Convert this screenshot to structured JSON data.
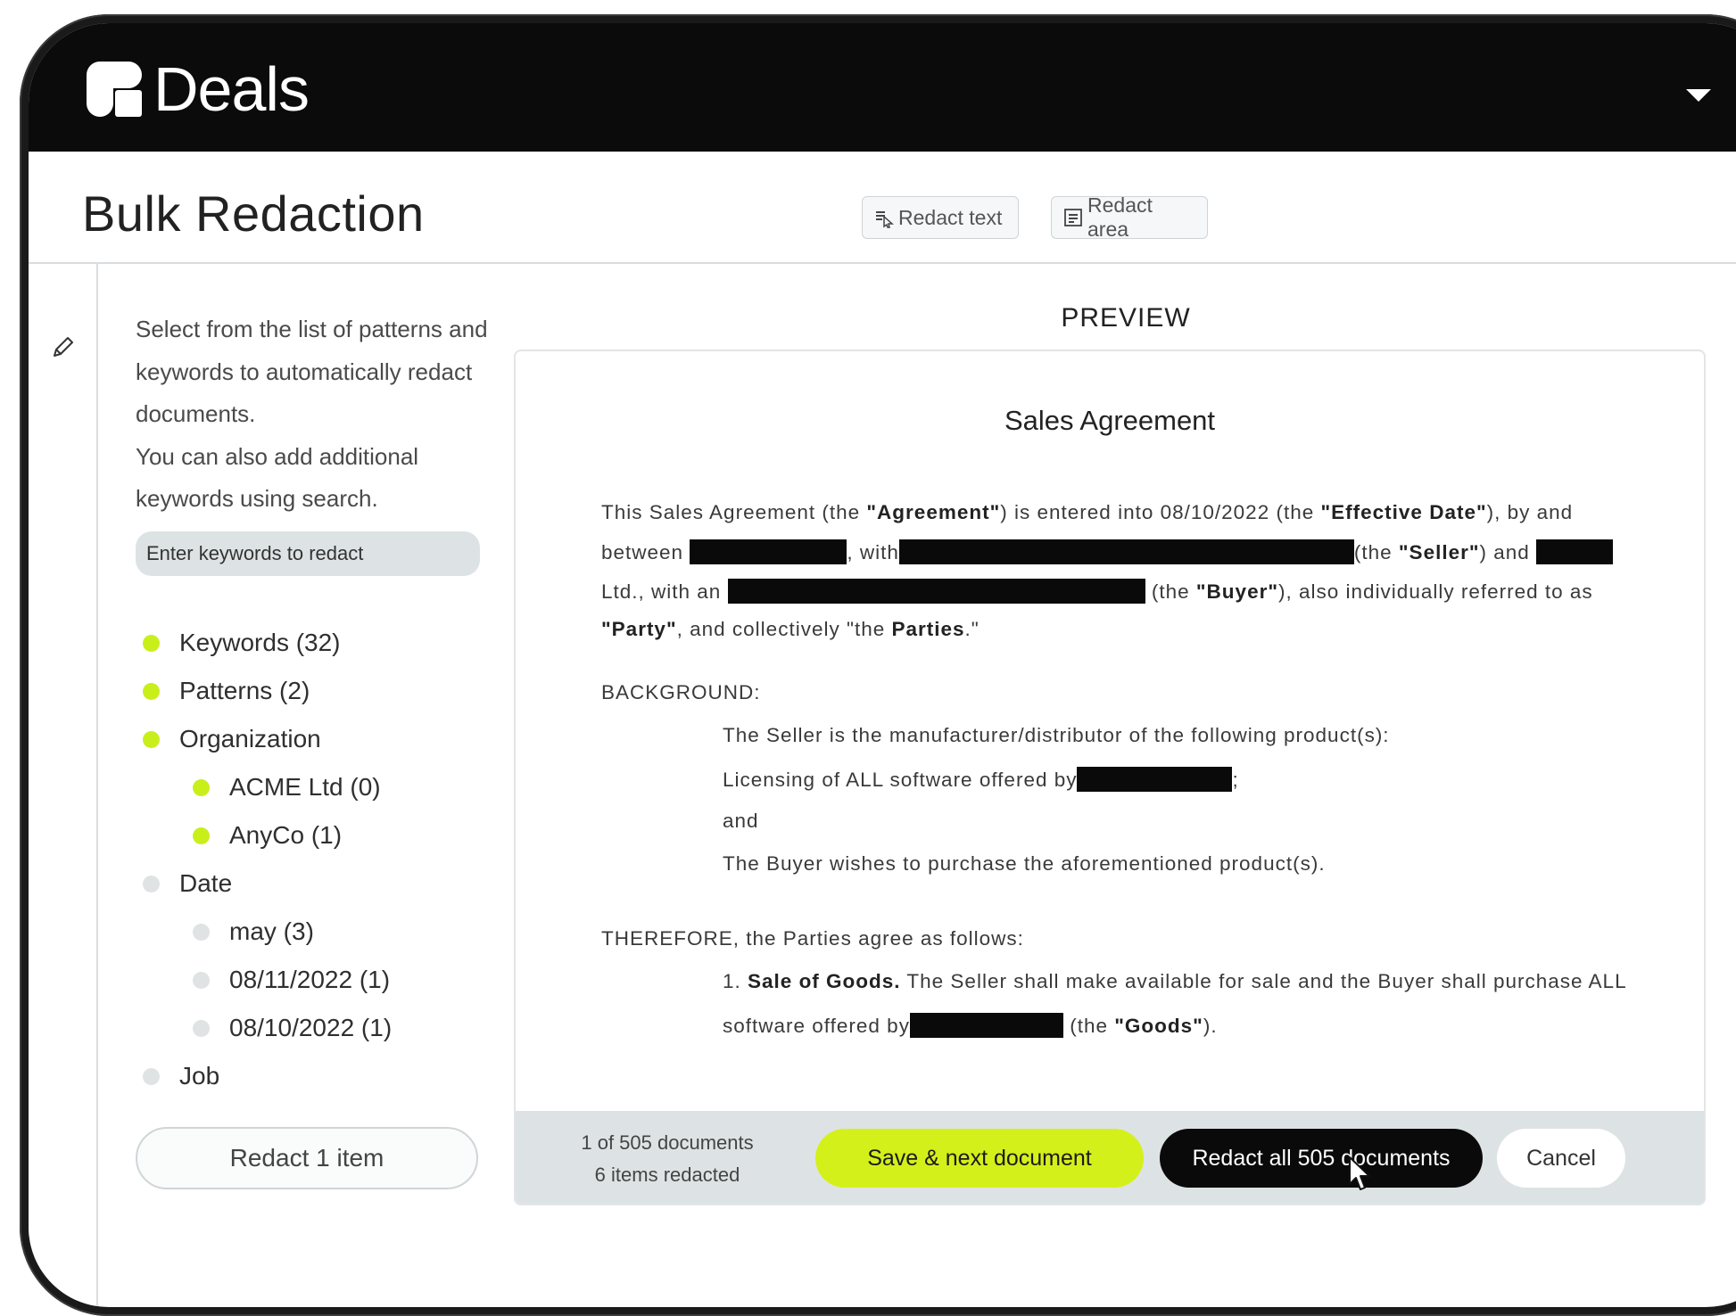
{
  "app": {
    "title": "Deals"
  },
  "page": {
    "title": "Bulk Redaction"
  },
  "toolbar": {
    "redact_text": "Redact text",
    "redact_area": "Redact area"
  },
  "sidebar": {
    "intro_1": "Select from the list of patterns and keywords to automatically redact documents.",
    "intro_2": "You can also add additional keywords using search.",
    "search_placeholder": "Enter keywords to redact",
    "filters": [
      {
        "label": "Keywords (32)",
        "active": true,
        "level": 0
      },
      {
        "label": "Patterns (2)",
        "active": true,
        "level": 0
      },
      {
        "label": "Organization",
        "active": true,
        "level": 0
      },
      {
        "label": "ACME Ltd (0)",
        "active": true,
        "level": 1
      },
      {
        "label": "AnyCo (1)",
        "active": true,
        "level": 1
      },
      {
        "label": "Date",
        "active": false,
        "level": 0
      },
      {
        "label": "may (3)",
        "active": false,
        "level": 1
      },
      {
        "label": "08/11/2022 (1)",
        "active": false,
        "level": 1
      },
      {
        "label": "08/10/2022 (1)",
        "active": false,
        "level": 1
      },
      {
        "label": "Job",
        "active": false,
        "level": 0
      }
    ],
    "redact_item_button": "Redact 1 item"
  },
  "preview": {
    "label": "PREVIEW",
    "doc_title": "Sales Agreement",
    "p1_a": "This Sales Agreement (the ",
    "p1_agreement": "\"Agreement\"",
    "p1_b": ") is entered into 08/10/2022 (the ",
    "p1_effective": "\"Effective Date\"",
    "p1_c": "), by and",
    "p2_between": "between",
    "p2_with": ", with",
    "p2_the": "(the ",
    "p2_seller": "\"Seller\"",
    "p2_and": ") and",
    "p3_ltd": "Ltd., with an",
    "p3_the": "(the ",
    "p3_buyer": "\"Buyer\"",
    "p3_rest": "), also individually referred to as",
    "p4_party": "\"Party\"",
    "p4_mid": ", and collectively \"the ",
    "p4_parties": "Parties",
    "p4_end": ".\"",
    "background": "BACKGROUND:",
    "bg_1": "The Seller is the manufacturer/distributor of the following product(s):",
    "bg_2a": "Licensing of ALL software offered by",
    "bg_2b": ";",
    "bg_3": "and",
    "bg_4": "The Buyer wishes to purchase the aforementioned product(s).",
    "therefore": "THEREFORE, the Parties agree as follows:",
    "item1_num": "1. ",
    "item1_bold": "Sale of Goods.",
    "item1_text": " The Seller shall make available for sale and the Buyer shall purchase ALL",
    "item1_b": "software offered by",
    "item1_the": " (the ",
    "item1_goods": "\"Goods\"",
    "item1_end": ")."
  },
  "footer": {
    "doc_position": "1 of 505 documents",
    "items_redacted": "6 items redacted",
    "save_next": "Save & next document",
    "redact_all": "Redact all 505 documents",
    "cancel": "Cancel"
  },
  "colors": {
    "accent": "#d4f01a",
    "header_bg": "#0b0b0b"
  },
  "icons": [
    "logo-icon",
    "chevron-down-icon",
    "redact-text-icon",
    "redact-area-icon",
    "pencil-icon",
    "cursor-icon"
  ]
}
